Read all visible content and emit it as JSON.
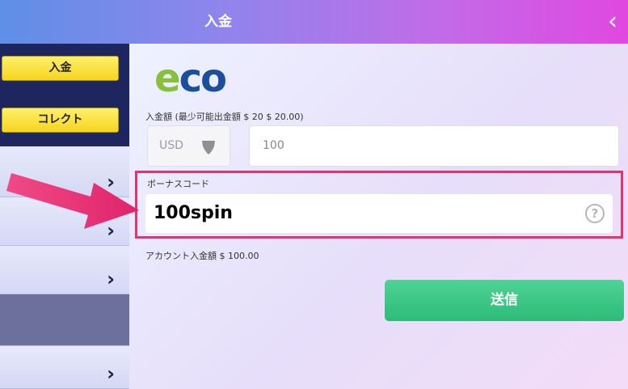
{
  "header": {
    "title": "入金",
    "back_glyph": "‹"
  },
  "sidebar": {
    "buttons": [
      {
        "label": "入金"
      },
      {
        "label": "コレクト"
      }
    ],
    "items": [
      {
        "chevron": "›",
        "active": false
      },
      {
        "chevron": "›",
        "active": false
      },
      {
        "chevron": "›",
        "active": false
      },
      {
        "chevron": "",
        "active": true
      },
      {
        "chevron": "›",
        "active": false
      }
    ]
  },
  "main": {
    "logo": {
      "e": "e",
      "co": "co"
    },
    "amount_label": "入金額 (最少可能出金額 $ 20  $ 20.00)",
    "currency": "USD",
    "amount_value": "100",
    "bonus_label": "ボーナスコード",
    "bonus_value": "100spin",
    "help_glyph": "?",
    "account_label": "アカウント入金額  $ 100.00",
    "send_label": "送信"
  },
  "colors": {
    "accent_pink": "#e6336b",
    "button_green": "#2dbb79",
    "button_yellow": "#f6d51e",
    "sidebar_dark": "#1e2660",
    "logo_green": "#87c13b",
    "logo_blue": "#1b4f9d"
  },
  "icons": [
    "back-chevron-icon",
    "chevron-right-icon",
    "shield-icon",
    "help-circle-icon",
    "pointer-arrow-icon"
  ]
}
